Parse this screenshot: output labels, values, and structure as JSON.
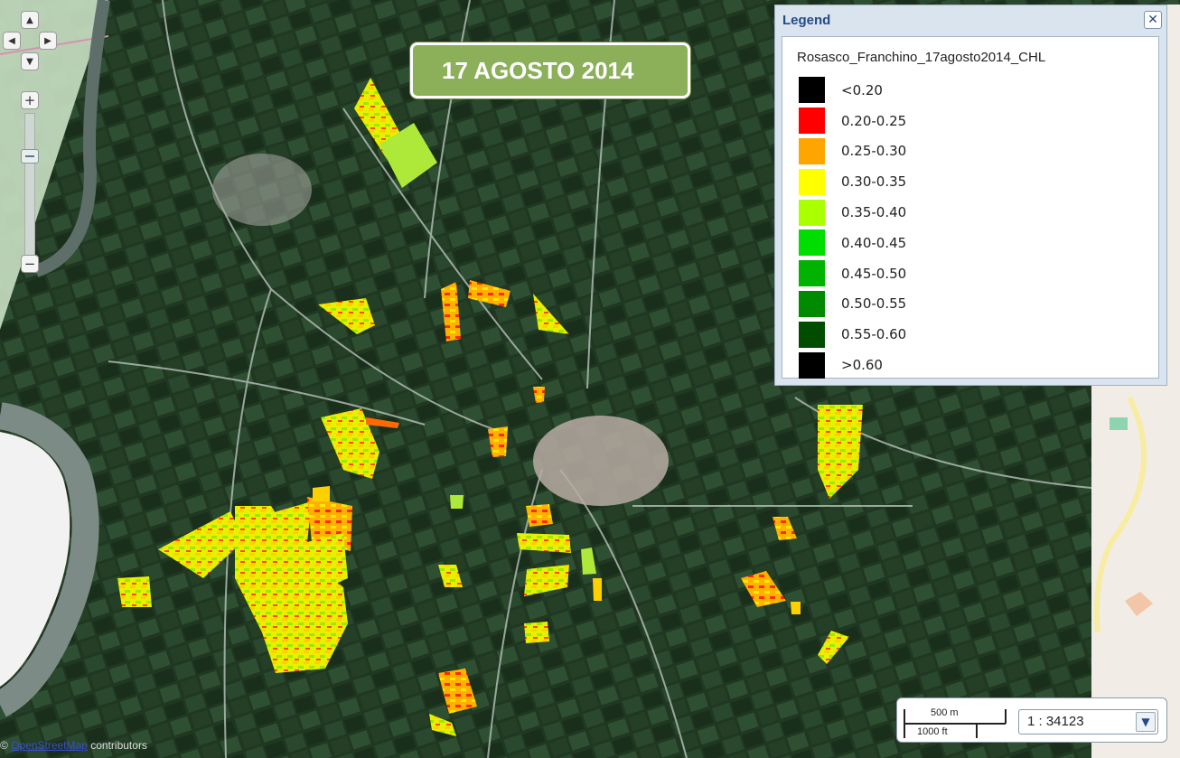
{
  "map": {
    "date_label": "17 AGOSTO 2014",
    "attribution_symbol": "©",
    "attribution_link": "OpenStreetMap",
    "attribution_suffix": " contributors",
    "icons": [
      "pan-up-icon",
      "pan-left-icon",
      "pan-right-icon",
      "pan-down-icon",
      "zoom-in-icon",
      "zoom-out-icon"
    ]
  },
  "navigation": {
    "pan_up": "▲",
    "pan_left": "◀",
    "pan_right": "▶",
    "pan_down": "▼",
    "zoom_in": "+",
    "zoom_out": "−"
  },
  "legend": {
    "title": "Legend",
    "close": "✕",
    "layer_name": "Rosasco_Franchino_17agosto2014_CHL",
    "items": [
      {
        "label": "<0.20",
        "color": "#000000"
      },
      {
        "label": "0.20-0.25",
        "color": "#ff0000"
      },
      {
        "label": "0.25-0.30",
        "color": "#ffa500"
      },
      {
        "label": "0.30-0.35",
        "color": "#ffff00"
      },
      {
        "label": "0.35-0.40",
        "color": "#aaff00"
      },
      {
        "label": "0.40-0.45",
        "color": "#00dd00"
      },
      {
        "label": "0.45-0.50",
        "color": "#00b300"
      },
      {
        "label": "0.50-0.55",
        "color": "#008a00"
      },
      {
        "label": "0.55-0.60",
        "color": "#004d00"
      },
      {
        "label": ">0.60",
        "color": "#000000"
      }
    ]
  },
  "scale": {
    "metric": "500 m",
    "imperial": "1000 ft",
    "ratio": "1 : 34123",
    "dropdown_arrow": "▼"
  }
}
